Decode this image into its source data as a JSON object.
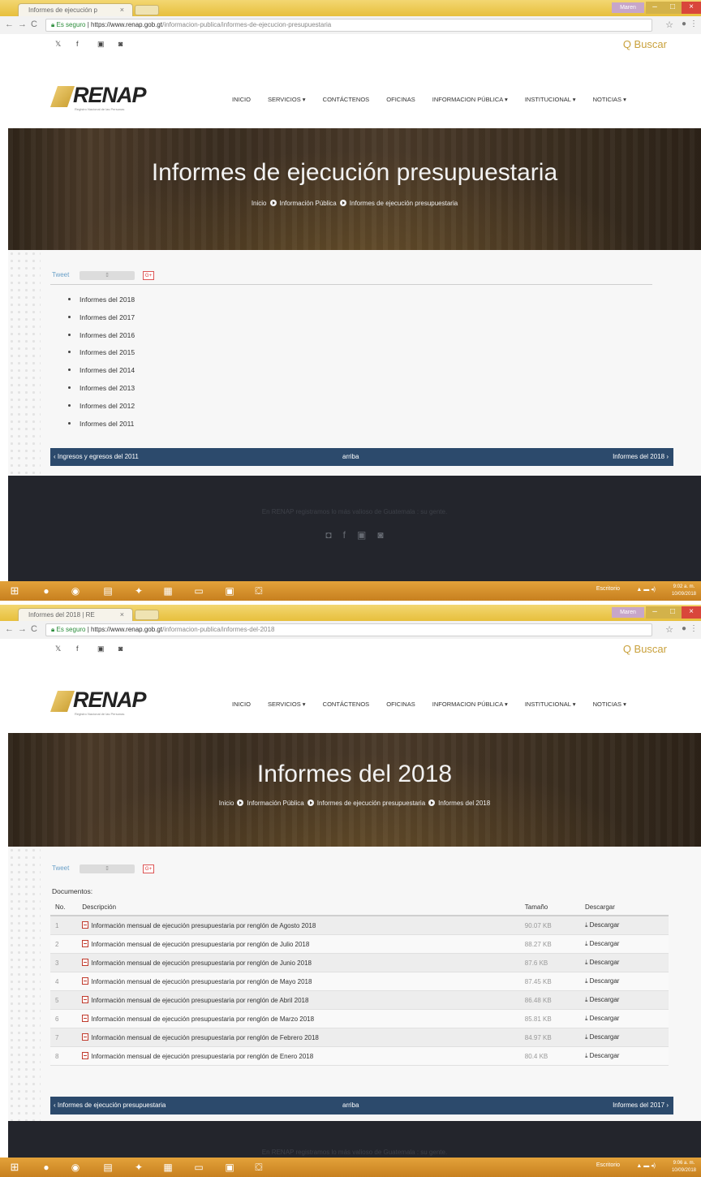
{
  "colors": {
    "accent": "#c9a13c",
    "pager": "#2c4a6c",
    "footer": "#23252c",
    "taskbar": "#d8921f"
  },
  "shot1": {
    "tab_title": "Informes de ejecución p",
    "url_secure": "Es seguro",
    "url_host": "https://www.renap.gob.gt",
    "url_path": "/informacion-publica/informes-de-ejecucion-presupuestaria",
    "hero_title": "Informes de ejecución presupuestaria",
    "crumbs": [
      "Inicio",
      "Información Pública",
      "Informes de ejecución presupuestaria"
    ],
    "years": [
      "Informes del 2018",
      "Informes del 2017",
      "Informes del 2016",
      "Informes del 2015",
      "Informes del 2014",
      "Informes del 2013",
      "Informes del 2012",
      "Informes del 2011"
    ],
    "pager": {
      "prev": "‹ Ingresos y egresos del 2011",
      "up": "arriba",
      "next": "Informes del 2018 ›"
    },
    "time": "9:02 a. m.",
    "date": "10/09/2018"
  },
  "shot2": {
    "tab_title": "Informes del 2018 | RE",
    "url_secure": "Es seguro",
    "url_host": "https://www.renap.gob.gt",
    "url_path": "/informacion-publica/informes-del-2018",
    "hero_title": "Informes del 2018",
    "crumbs": [
      "Inicio",
      "Información Pública",
      "Informes de ejecución presupuestaria",
      "Informes del 2018"
    ],
    "docs_label": "Documentos:",
    "headers": {
      "no": "No.",
      "desc": "Descripción",
      "size": "Tamaño",
      "dl": "Descargar"
    },
    "rows": [
      {
        "no": "1",
        "desc": "Información mensual de ejecución presupuestaria por renglón de Agosto 2018",
        "size": "90.07 KB",
        "dl": "Descargar"
      },
      {
        "no": "2",
        "desc": "Información mensual de ejecución presupuestaria por renglón de Julio 2018",
        "size": "88.27 KB",
        "dl": "Descargar"
      },
      {
        "no": "3",
        "desc": "Información mensual de ejecución presupuestaria por renglón de Junio 2018",
        "size": "87.6 KB",
        "dl": "Descargar"
      },
      {
        "no": "4",
        "desc": "Información mensual de ejecución presupuestaria por renglón de Mayo 2018",
        "size": "87.45 KB",
        "dl": "Descargar"
      },
      {
        "no": "5",
        "desc": "Información mensual de ejecución presupuestaria por renglón de Abril 2018",
        "size": "86.48 KB",
        "dl": "Descargar"
      },
      {
        "no": "6",
        "desc": "Información mensual de ejecución presupuestaria por renglón de Marzo 2018",
        "size": "85.81 KB",
        "dl": "Descargar"
      },
      {
        "no": "7",
        "desc": "Información mensual de ejecución presupuestaria por renglón de Febrero 2018",
        "size": "84.97 KB",
        "dl": "Descargar"
      },
      {
        "no": "8",
        "desc": "Información mensual de ejecución presupuestaria por renglón de Enero 2018",
        "size": "80.4 KB",
        "dl": "Descargar"
      }
    ],
    "pager": {
      "prev": "‹ Informes de ejecución presupuestaria",
      "up": "arriba",
      "next": "Informes del 2017 ›"
    },
    "time": "9:06 a. m.",
    "date": "10/09/2018"
  },
  "common": {
    "window_user": "Maren",
    "search_label": "Q Buscar",
    "logo_text": "RENAP",
    "logo_sub": "Registro Nacional de las Personas",
    "nav": [
      "INICIO",
      "SERVICIOS ▾",
      "CONTÁCTENOS",
      "OFICINAS",
      "INFORMACION PÚBLICA ▾",
      "INSTITUCIONAL ▾",
      "NOTICIAS ▾"
    ],
    "tweet": "Tweet",
    "gplus": "G+",
    "footer_text": "En RENAP registramos lo más valioso de Guatemala : su gente.",
    "desktop_label": "Escritorio",
    "icons": [
      "twitter-icon",
      "facebook-icon",
      "youtube-icon",
      "instagram-icon"
    ]
  }
}
